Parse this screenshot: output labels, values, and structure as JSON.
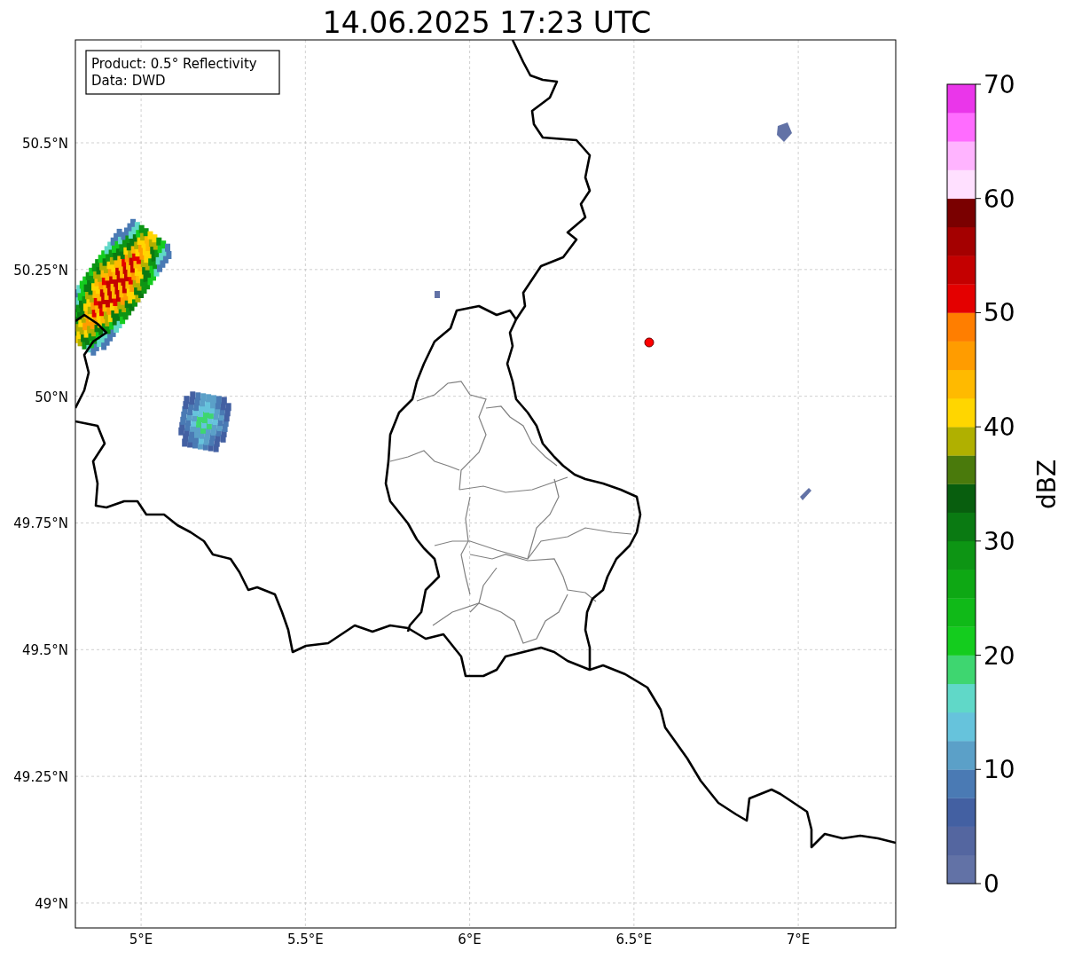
{
  "title": "14.06.2025 17:23 UTC",
  "info_box": [
    "Product: 0.5° Reflectivity",
    "Data: DWD"
  ],
  "lat_labels": [
    "50.5°N",
    "50.25°N",
    "50°N",
    "49.75°N",
    "49.5°N",
    "49.25°N",
    "49°N"
  ],
  "lon_labels": [
    "5°E",
    "5.5°E",
    "6°E",
    "6.5°E",
    "7°E"
  ],
  "colorbar": {
    "label": "dBZ",
    "ticks": [
      "70",
      "60",
      "50",
      "40",
      "30",
      "20",
      "10",
      "0"
    ],
    "segments": [
      {
        "color": "#6272a6"
      },
      {
        "color": "#5466a0"
      },
      {
        "color": "#4360a2"
      },
      {
        "color": "#4a7ab4"
      },
      {
        "color": "#5ba0c8"
      },
      {
        "color": "#66c3dc"
      },
      {
        "color": "#60d8c8"
      },
      {
        "color": "#3ed670"
      },
      {
        "color": "#14cc1e"
      },
      {
        "color": "#10ba18"
      },
      {
        "color": "#0ea814"
      },
      {
        "color": "#0d9514"
      },
      {
        "color": "#0a7a12"
      },
      {
        "color": "#085e0e"
      },
      {
        "color": "#4a7a0c"
      },
      {
        "color": "#b0b000"
      },
      {
        "color": "#ffd600"
      },
      {
        "color": "#ffba00"
      },
      {
        "color": "#ff9c00"
      },
      {
        "color": "#ff7e00"
      },
      {
        "color": "#e40000"
      },
      {
        "color": "#c40000"
      },
      {
        "color": "#a40000"
      },
      {
        "color": "#7a0000"
      },
      {
        "color": "#ffe0ff"
      },
      {
        "color": "#ffb4ff"
      },
      {
        "color": "#ff6cff"
      },
      {
        "color": "#ea36ea"
      }
    ]
  }
}
